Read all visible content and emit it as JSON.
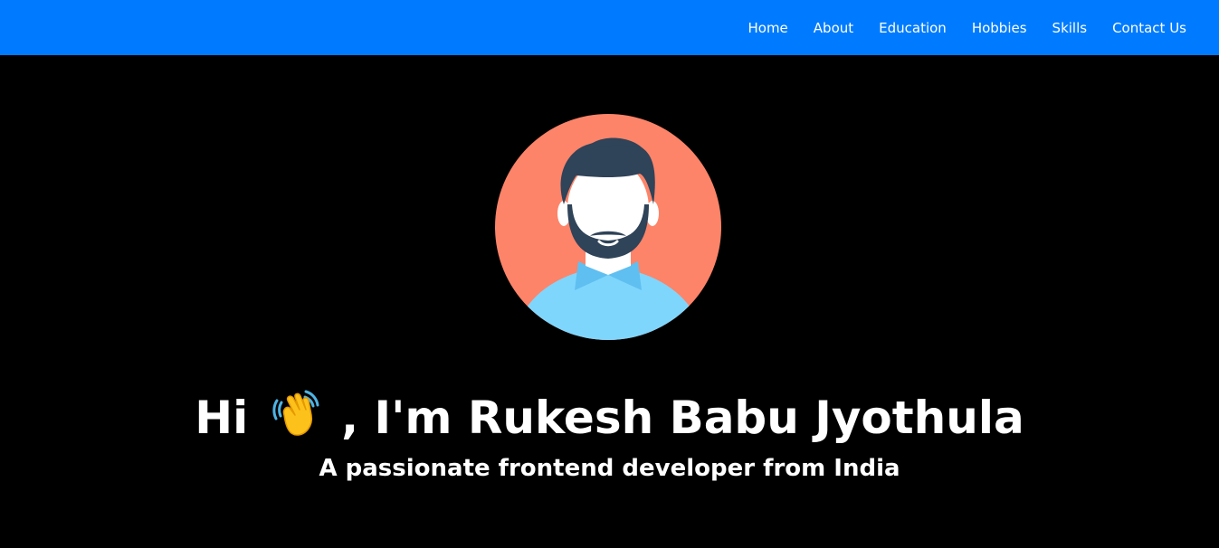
{
  "nav": {
    "items": [
      {
        "label": "Home"
      },
      {
        "label": "About"
      },
      {
        "label": "Education"
      },
      {
        "label": "Hobbies"
      },
      {
        "label": "Skills"
      },
      {
        "label": "Contact Us"
      }
    ]
  },
  "hero": {
    "greeting_prefix": "Hi",
    "greeting_suffix": ", I'm Rukesh Babu Jyothula",
    "wave_icon": "waving-hand-emoji",
    "subtitle": "A passionate frontend developer from India",
    "avatar_icon": "male-avatar-illustration"
  },
  "colors": {
    "navbar": "#007bff",
    "hero_background": "#000000",
    "avatar_circle": "#fd8469",
    "hair": "#2f4359",
    "shirt": "#7fd6fd",
    "collar": "#5fbff0"
  }
}
